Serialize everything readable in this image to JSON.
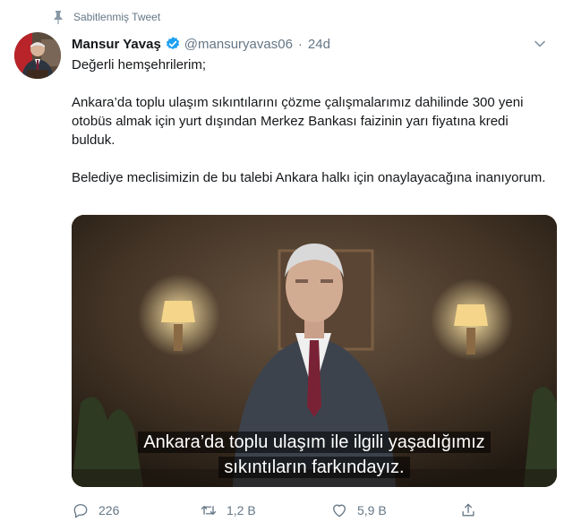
{
  "pinned": {
    "label": "Sabitlenmiş Tweet",
    "icon": "pin-icon"
  },
  "author": {
    "name": "Mansur Yavaş",
    "handle": "@mansuryavas06",
    "separator": "·",
    "time": "24d",
    "verified": true,
    "verified_color": "#1da1f2"
  },
  "tweet": {
    "paragraphs": [
      "Değerli hemşehrilerim;",
      "Ankara’da toplu ulaşım sıkıntılarını çözme çalışmalarımız dahilinde 300 yeni otobüs almak için yurt dışından Merkez Bankası faizinin yarı fiyatına kredi bulduk.",
      "Belediye meclisimizin de bu talebi Ankara halkı için onaylayacağına inanıyorum."
    ]
  },
  "media": {
    "subtitle_line1": "Ankara’da toplu ulaşım ile ilgili yaşadığımız",
    "subtitle_line2": "sıkıntıların farkındayız."
  },
  "actions": {
    "reply": {
      "count": "226",
      "icon": "reply-icon"
    },
    "retweet": {
      "count": "1,2 B",
      "icon": "retweet-icon"
    },
    "like": {
      "count": "5,9 B",
      "icon": "heart-icon"
    },
    "share": {
      "icon": "share-icon"
    }
  },
  "colors": {
    "text": "#14171a",
    "muted": "#657786",
    "accent": "#1da1f2"
  }
}
